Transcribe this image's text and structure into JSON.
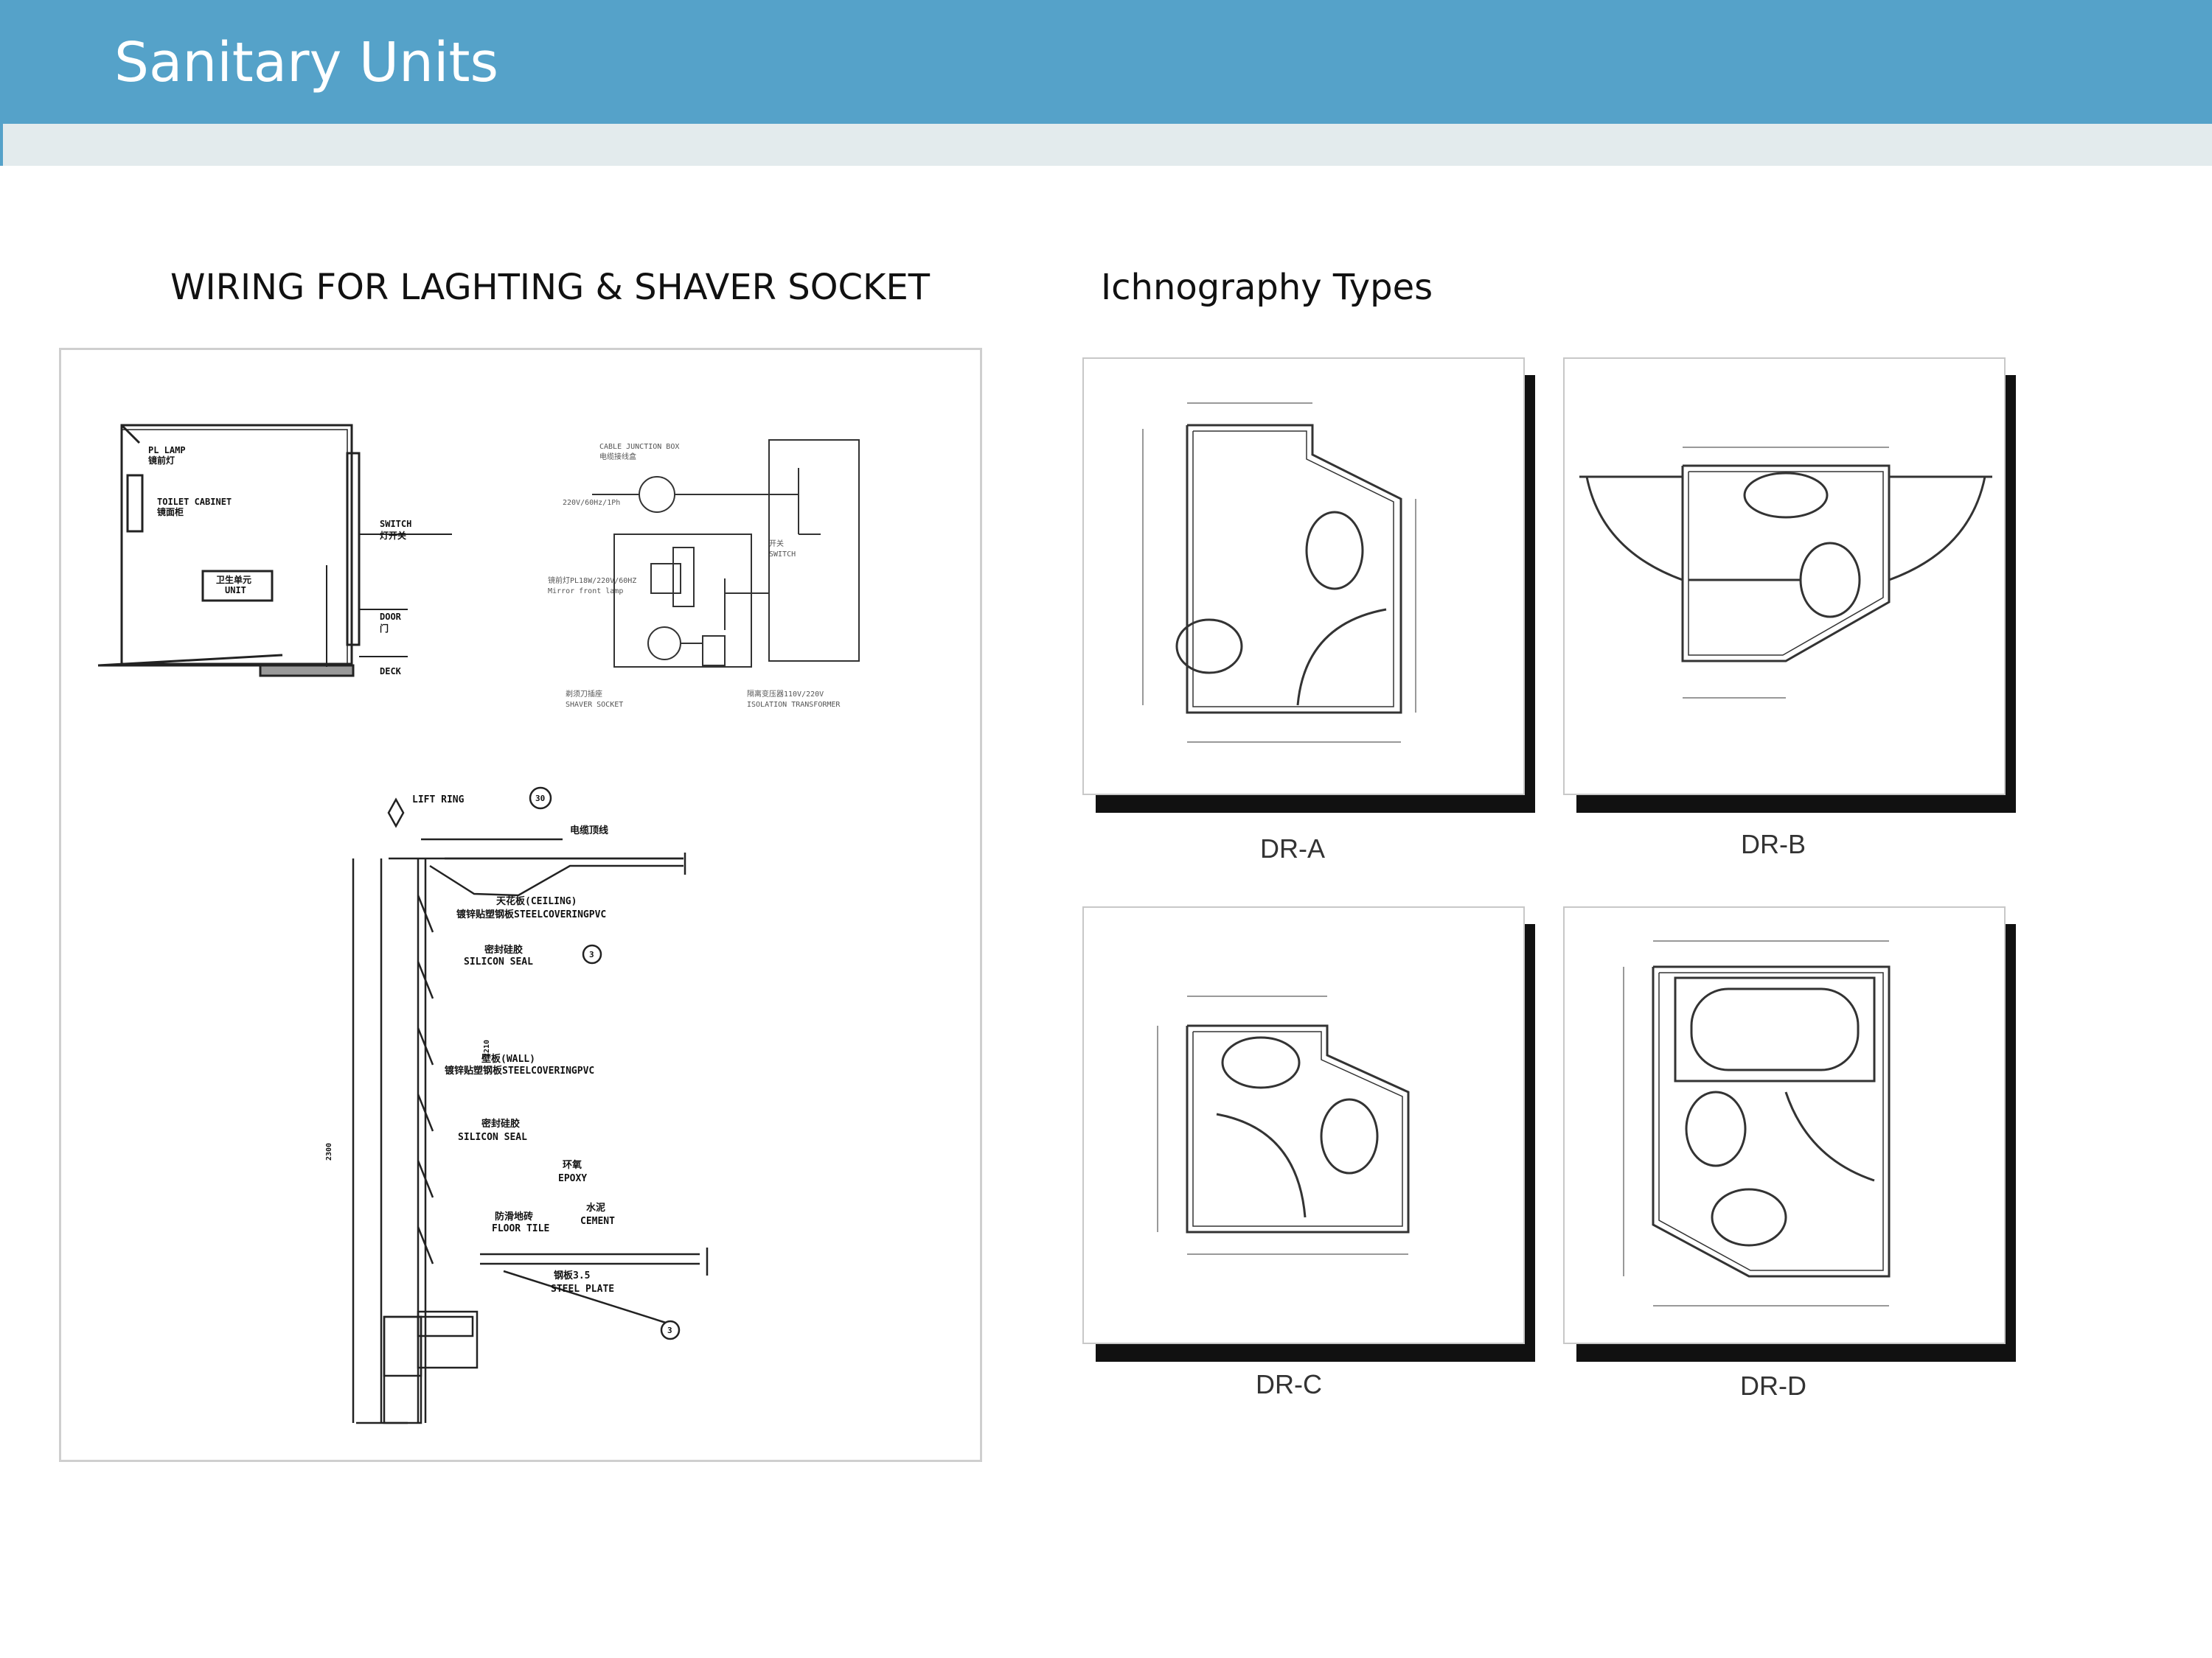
{
  "header": {
    "title": "Sanitary Units"
  },
  "left_section": {
    "title": "WIRING FOR LAGHTING & SHAVER SOCKET",
    "elevation": {
      "pl_lamp": "PL LAMP",
      "pl_lamp_cn": "镜前灯",
      "toilet_cabinet": "TOILET CABINET",
      "toilet_cabinet_cn": "镜面柜",
      "unit_cn": "卫生单元",
      "unit": "UNIT",
      "switch": "SWITCH",
      "switch_cn": "灯开关",
      "door": "DOOR",
      "door_cn": "门",
      "deck": "DECK"
    },
    "circuit": {
      "junction_box": "CABLE JUNCTION BOX",
      "junction_box_cn": "电缆接线盒",
      "supply": "220V/60Hz/1Ph",
      "switch_cn": "开关",
      "switch": "SWITCH",
      "mirror_lamp_cn": "镜前灯PL18W/220V/60HZ",
      "mirror_lamp": "Mirror front lamp",
      "shaver_socket_cn": "剃须刀插座",
      "shaver_socket": "SHAVER SOCKET",
      "transformer_cn": "隔离变压器110V/220V",
      "transformer": "ISOLATION TRANSFORMER"
    },
    "section": {
      "lift_ring": "LIFT RING",
      "cable_cn": "电缆顶线",
      "ceiling_cn": "天花板(CEILING)",
      "steel_covering_1": "镀锌贴塑钢板STEELCOVERINGPVC",
      "silicon_seal_cn_1": "密封硅胶",
      "silicon_seal_1": "SILICON SEAL",
      "wall_cn": "壁板(WALL)",
      "steel_covering_2": "镀锌贴塑钢板STEELCOVERINGPVC",
      "silicon_seal_cn_2": "密封硅胶",
      "silicon_seal_2": "SILICON SEAL",
      "epoxy_cn": "环氧",
      "epoxy": "EPOXY",
      "floor_tile_cn": "防滑地砖",
      "floor_tile": "FLOOR TILE",
      "cement_cn": "水泥",
      "cement": "CEMENT",
      "steel_plate_cn": "钢板3.5",
      "steel_plate": "STEEL PLATE",
      "dim_height": "2300",
      "dim_inner": "2210",
      "callout_30": "30",
      "callout_3": "3"
    }
  },
  "right_section": {
    "title": "Ichnography Types",
    "plans": [
      {
        "label": "DR-A"
      },
      {
        "label": "DR-B"
      },
      {
        "label": "DR-C"
      },
      {
        "label": "DR-D"
      }
    ]
  }
}
